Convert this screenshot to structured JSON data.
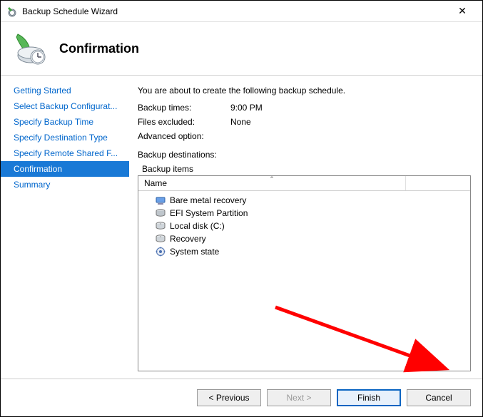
{
  "window": {
    "title": "Backup Schedule Wizard"
  },
  "header": {
    "heading": "Confirmation"
  },
  "sidebar": {
    "steps": [
      "Getting Started",
      "Select Backup Configurat...",
      "Specify Backup Time",
      "Specify Destination Type",
      "Specify Remote Shared F...",
      "Confirmation",
      "Summary"
    ],
    "selected_index": 5
  },
  "main": {
    "intro": "You are about to create the following backup schedule.",
    "backup_times_label": "Backup times:",
    "backup_times_value": "9:00 PM",
    "files_excluded_label": "Files excluded:",
    "files_excluded_value": "None",
    "advanced_option_label": "Advanced option:",
    "advanced_option_value": "",
    "backup_destinations_label": "Backup destinations:",
    "backup_destinations_value": "",
    "backup_items_label": "Backup items",
    "column_name": "Name",
    "items": [
      {
        "icon": "bare-metal",
        "label": "Bare metal recovery"
      },
      {
        "icon": "partition",
        "label": "EFI System Partition"
      },
      {
        "icon": "disk",
        "label": "Local disk (C:)"
      },
      {
        "icon": "disk",
        "label": "Recovery"
      },
      {
        "icon": "system",
        "label": "System state"
      }
    ]
  },
  "footer": {
    "previous": "< Previous",
    "next": "Next >",
    "finish": "Finish",
    "cancel": "Cancel"
  }
}
